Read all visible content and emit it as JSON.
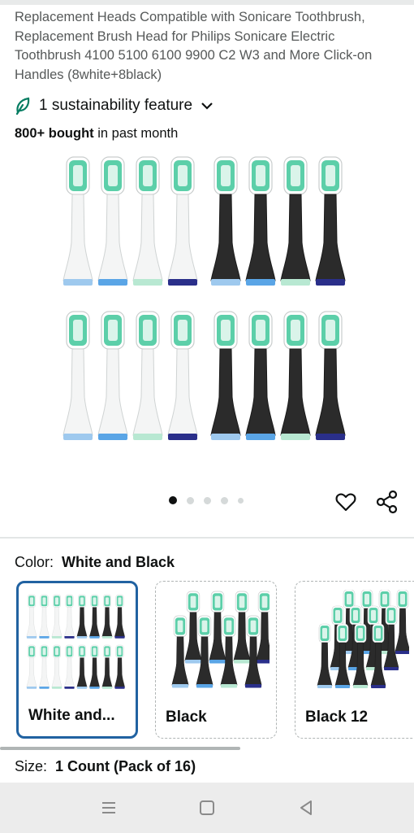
{
  "product": {
    "title": "Replacement Heads Compatible with Sonicare Toothbrush, Replacement Brush Head for Philips Sonicare Electric Toothbrush 4100 5100 6100 9900 C2 W3 and More Click-on Handles (8white+8black)",
    "sustainability": "1 sustainability feature",
    "bought_bold": "800+ bought",
    "bought_rest": " in past month"
  },
  "gallery": {
    "image_count": 5,
    "active_index": 0
  },
  "variants": {
    "color_label": "Color:",
    "color_value": "White and Black",
    "options": [
      {
        "label": "White and...",
        "selected": true
      },
      {
        "label": "Black",
        "selected": false
      },
      {
        "label": "Black 12",
        "selected": false
      }
    ],
    "size_label": "Size:",
    "size_value": "1 Count (Pack of 16)"
  },
  "colors": {
    "selected_border": "#2162a1",
    "brush_green": "#3fc79a",
    "white_head": "#f4f5f5",
    "black_head": "#2b2b2b"
  }
}
